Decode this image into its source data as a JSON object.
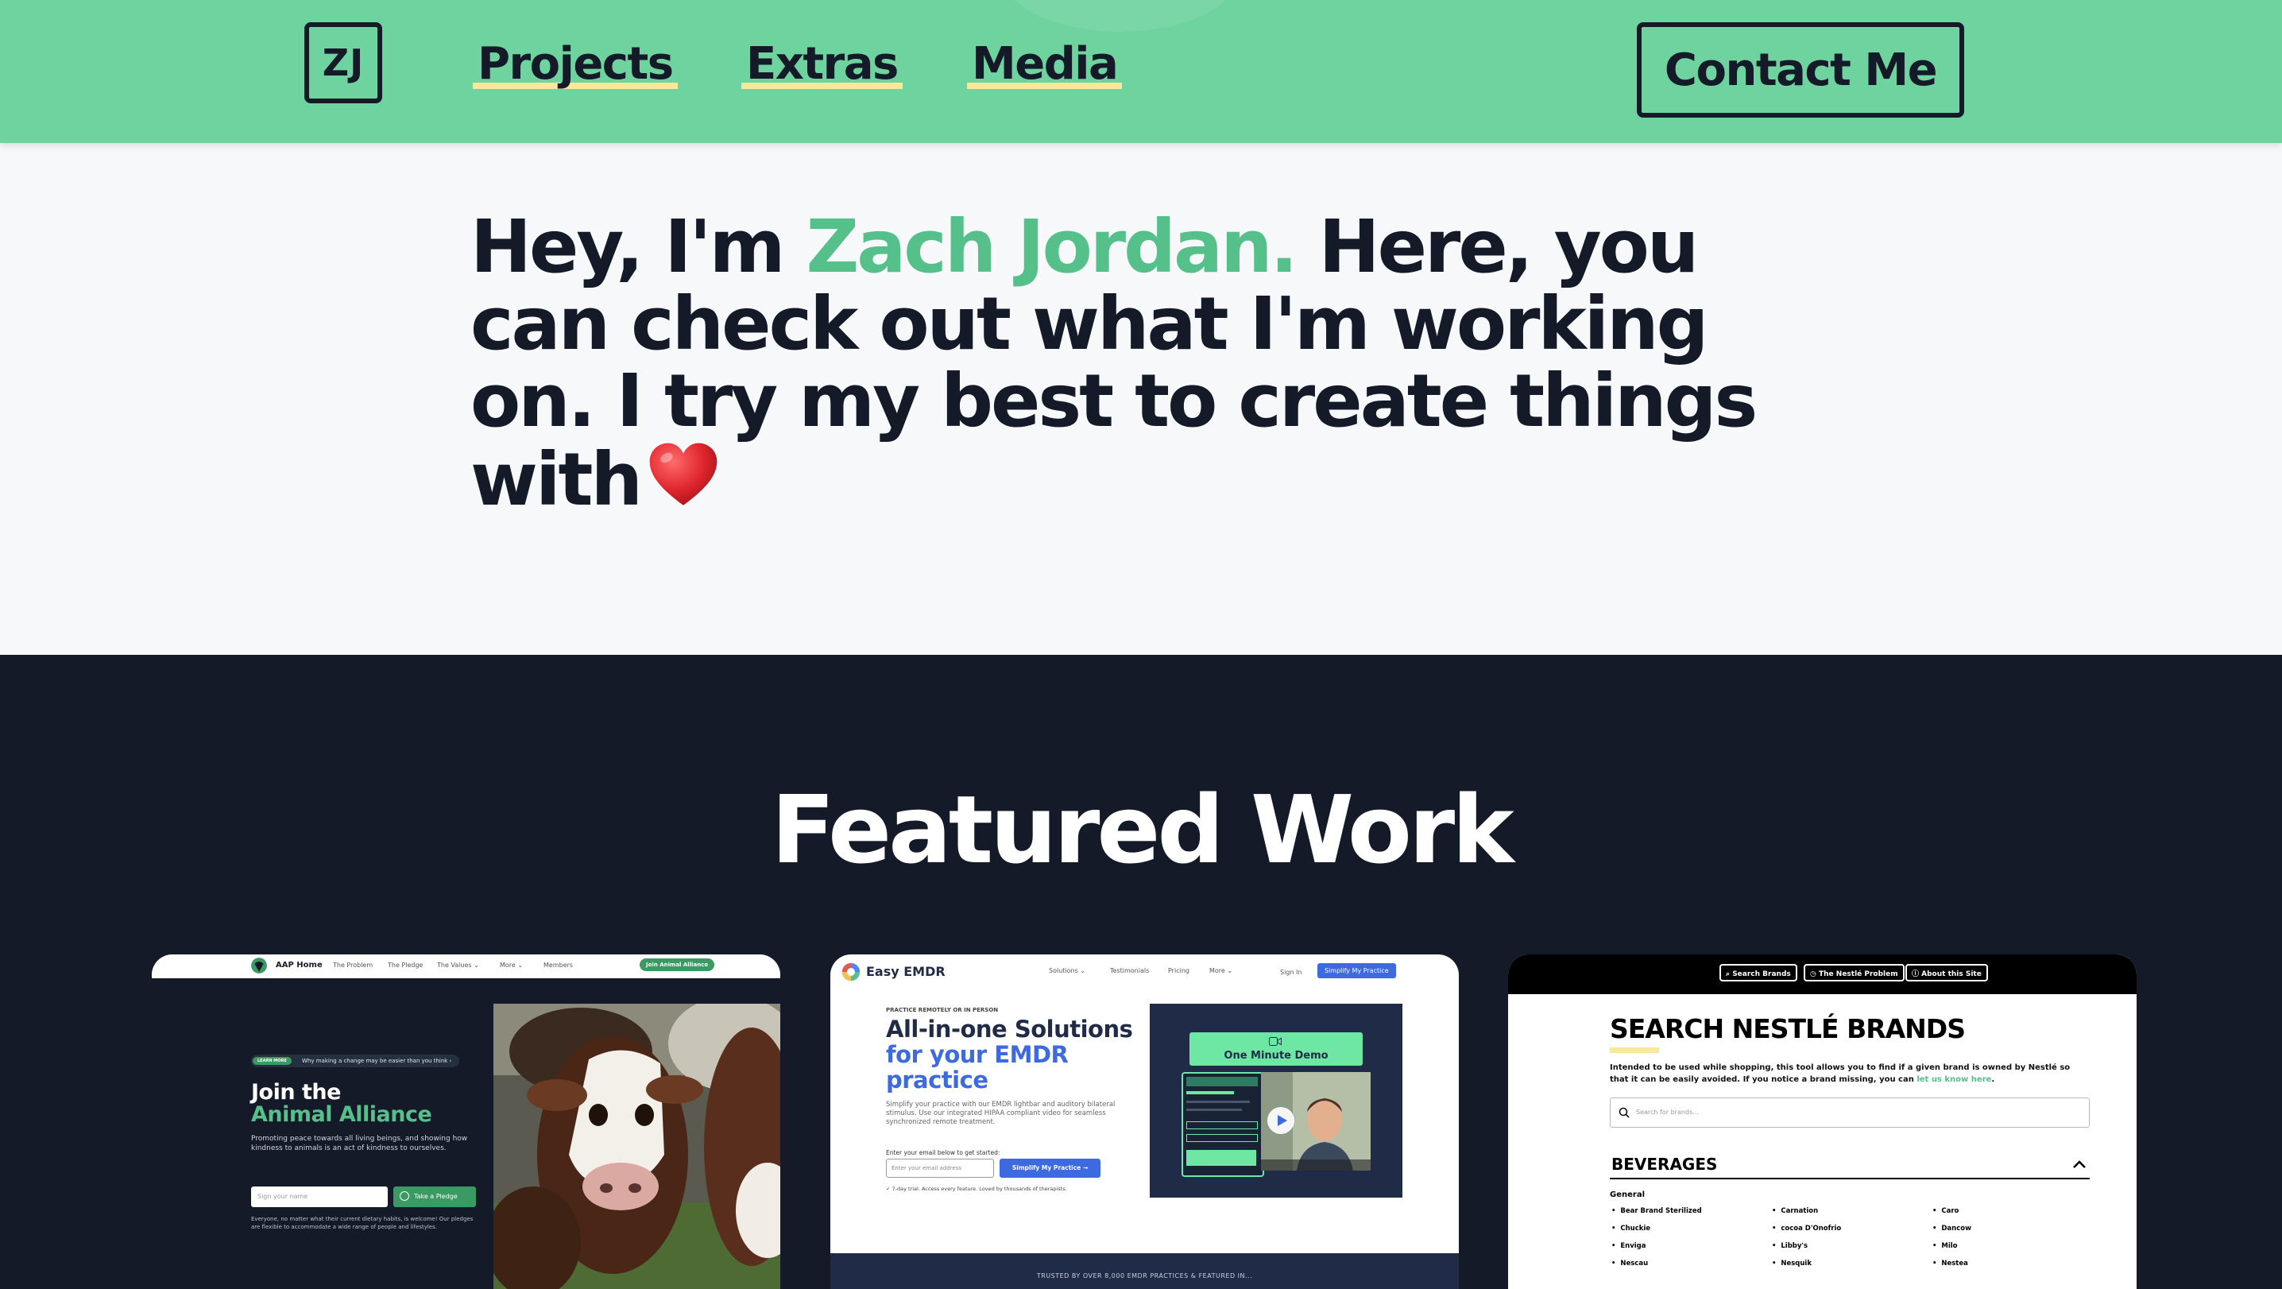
{
  "header": {
    "logo_text": "ZJ",
    "nav": [
      "Projects",
      "Extras",
      "Media"
    ],
    "contact_label": "Contact Me"
  },
  "hero": {
    "intro": "Hey, I'm ",
    "name": "Zach Jordan.",
    "rest": " Here, you can check out what I'm working on. I try my best to create things with",
    "heart_icon": "heart-icon"
  },
  "featured": {
    "title": "Featured Work",
    "cards": [
      {
        "nav_brand": "AAP Home",
        "nav_links": [
          "The Problem",
          "The Pledge",
          "The Values ⌄",
          "More ⌄",
          "Members"
        ],
        "nav_cta": "Join Animal Alliance",
        "badge": "LEARN MORE",
        "badge_text": "Why making a change may be easier than you think  ›",
        "heading_1": "Join the",
        "heading_2": "Animal Alliance",
        "subtext": "Promoting peace towards all living beings, and showing how kindness to animals is an act of kindness to ourselves.",
        "input_placeholder": "Sign your name",
        "button": "Take a Pledge",
        "footnote": "Everyone, no matter what their current dietary habits, is welcome! Our pledges are flexible to accommodate a wide range of people and lifestyles."
      },
      {
        "brand": "Easy EMDR",
        "nav_links": [
          "Solutions ⌄",
          "Testimonials",
          "Pricing",
          "More ⌄"
        ],
        "sign_in": "Sign In",
        "nav_cta": "Simplify My Practice",
        "eyebrow": "PRACTICE REMOTELY OR IN PERSON",
        "heading_1": "All-in-one Solutions",
        "heading_2": "for your EMDR",
        "heading_3": "practice",
        "subtext": "Simplify your practice with our EMDR lightbar and auditory bilateral stimulus. Use our integrated HIPAA compliant video for seamless synchronized remote treatment.",
        "email_label": "Enter your email below to get started:",
        "email_placeholder": "Enter your email address",
        "button": "Simplify My Practice →",
        "trial_note": "✓ 7-day trial. Access every feature. Loved by thousands of therapists.",
        "demo_label": "One Minute Demo",
        "trusted": "TRUSTED BY OVER 8,000 EMDR PRACTICES & FEATURED IN..."
      },
      {
        "top_buttons": [
          "Search Brands",
          "The Nestlé Problem",
          "About this Site"
        ],
        "title": "SEARCH NESTLÉ BRANDS",
        "desc": "Intended to be used while shopping, this tool allows you to find if a given brand is owned by Nestlé so that it can be easily avoided. If you notice a brand missing, you can ",
        "desc_link": "let us know here",
        "desc_end": ".",
        "search_placeholder": "Search for brands...",
        "section": "BEVERAGES",
        "subsection": "General",
        "col1": [
          "Bear Brand Sterilized",
          "Chuckie",
          "Enviga",
          "Nescau"
        ],
        "col2": [
          "Carnation",
          "cocoa D'Onofrio",
          "Libby's",
          "Nesquik"
        ],
        "col3": [
          "Caro",
          "Dancow",
          "Milo",
          "Nestea"
        ]
      }
    ]
  },
  "colors": {
    "header_bg": "#6fd3a0",
    "accent_green": "#56c08b",
    "dark_bg": "#141a28",
    "underline_yellow": "#f8e99a"
  }
}
